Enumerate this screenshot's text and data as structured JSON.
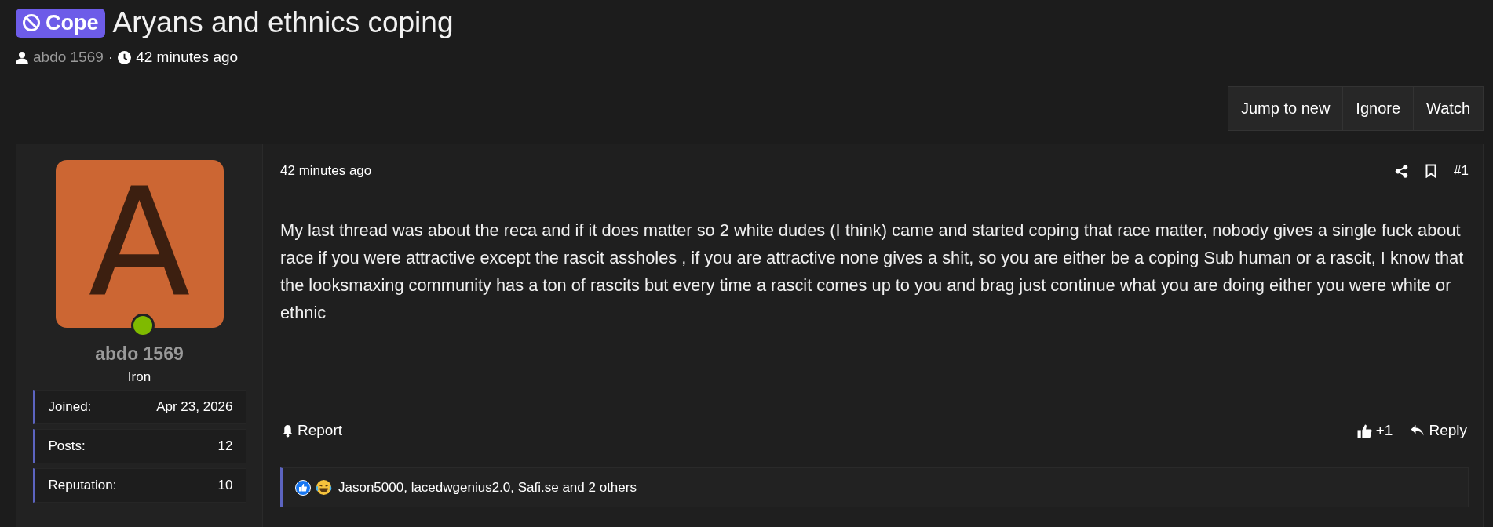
{
  "thread": {
    "prefix": "Cope",
    "title": "Aryans and ethnics coping",
    "author": "abdo 1569",
    "separator": "·",
    "time": "42 minutes ago"
  },
  "thread_buttons": [
    "Jump to new",
    "Ignore",
    "Watch"
  ],
  "post": {
    "user": {
      "avatar_letter": "A",
      "online": true,
      "name": "abdo 1569",
      "rank": "Iron",
      "stats": [
        {
          "label": "Joined:",
          "value": "Apr 23, 2026"
        },
        {
          "label": "Posts:",
          "value": "12"
        },
        {
          "label": "Reputation:",
          "value": "10"
        }
      ]
    },
    "time": "42 minutes ago",
    "number": "#1",
    "body": "My last thread was about the reca and if it does matter so 2 white dudes (I think) came and started coping that race matter, nobody gives a single fuck about race if you were attractive except the rascit assholes , if you are attractive none gives a shit, so you are either be a coping Sub human or a rascit, I know that the looksmaxing community has a ton of rascits but every time a rascit comes up to you and brag just continue what you are doing either you were white or ethnic",
    "report": "Report",
    "likes": "+1",
    "reply": "Reply",
    "reactions": "Jason5000, lacedwgenius2.0, Safi.se and 2 others"
  }
}
